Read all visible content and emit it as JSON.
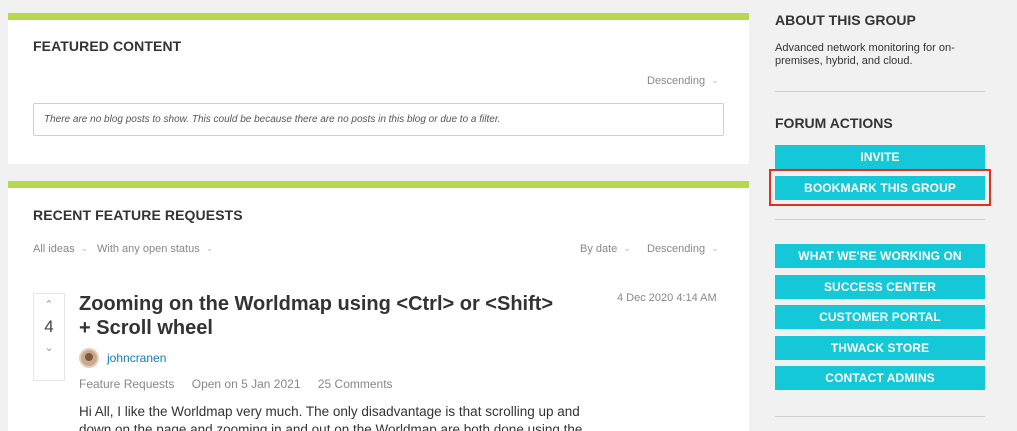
{
  "featured": {
    "title": "FEATURED CONTENT",
    "sort_label": "Descending",
    "empty_message": "There are no blog posts to show. This could be because there are no posts in this blog or due to a filter."
  },
  "recent": {
    "title": "RECENT FEATURE REQUESTS",
    "filter_ideas": "All ideas",
    "filter_status": "With any open status",
    "sort_by": "By date",
    "sort_order": "Descending",
    "post": {
      "votes": "4",
      "title": "Zooming on the Worldmap using <Ctrl> or <Shift> + Scroll wheel",
      "date": "4 Dec 2020 4:14 AM",
      "author": "johncranen",
      "category": "Feature Requests",
      "status": "Open on 5 Jan 2021",
      "comments": "25 Comments",
      "excerpt": "Hi All, I like the Worldmap very much. The only disadvantage is that scrolling up and down on the page and zooming in and out on the Worldmap are both done using the"
    }
  },
  "sidebar": {
    "about_heading": "ABOUT THIS GROUP",
    "about_text": "Advanced network monitoring for on-premises, hybrid, and cloud.",
    "actions_heading": "FORUM ACTIONS",
    "invite_label": "INVITE",
    "bookmark_label": "BOOKMARK THIS GROUP",
    "links": [
      "WHAT WE'RE WORKING ON",
      "SUCCESS CENTER",
      "CUSTOMER PORTAL",
      "THWACK STORE",
      "CONTACT ADMINS"
    ]
  },
  "colors": {
    "accent_bar": "#b5d84c",
    "button": "#14c8d8",
    "highlight": "#e0301e",
    "link": "#0f7eb0"
  }
}
